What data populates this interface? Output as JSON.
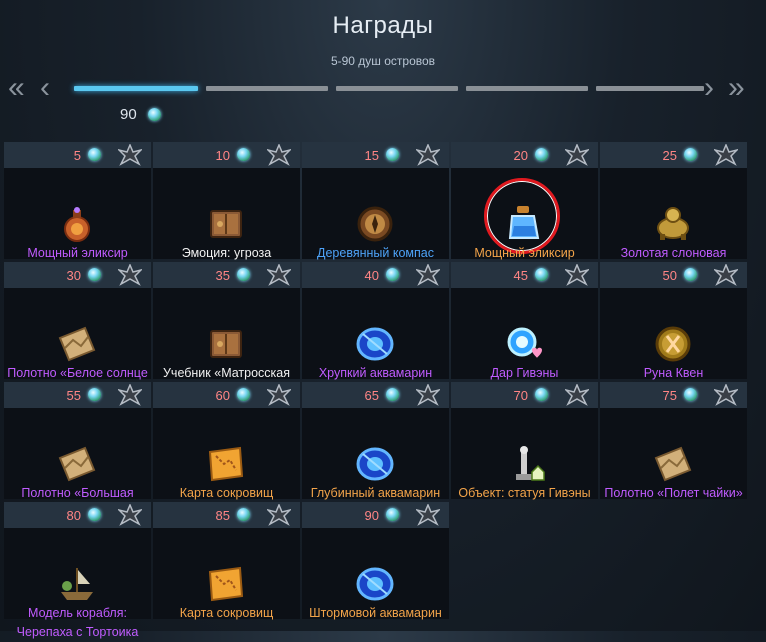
{
  "header": {
    "title": "Награды",
    "subtitle": "5-90 душ островов",
    "progress_value": "90"
  },
  "nav": {
    "first": "«",
    "prev": "‹",
    "next": "›",
    "last": "»"
  },
  "rewards": [
    {
      "souls": "5",
      "name": "Мощный эликсир «Благословени…",
      "color": "#c05cff",
      "icon": "elixir-icon"
    },
    {
      "souls": "10",
      "name": "Эмоция: угроза",
      "color": "#f1f1f1",
      "icon": "book-icon"
    },
    {
      "souls": "15",
      "name": "Деревянный компас",
      "color": "#4ea3f8",
      "icon": "compass-icon"
    },
    {
      "souls": "20",
      "name": "Мощный эликсир умений",
      "color": "#f3a44a",
      "icon": "potion-icon"
    },
    {
      "souls": "25",
      "name": "Золотая слоновая черепаха",
      "color": "#c05cff",
      "icon": "turtle-icon"
    },
    {
      "souls": "30",
      "name": "Полотно «Белое солнце Гуджира»",
      "color": "#c05cff",
      "icon": "canvas-icon"
    },
    {
      "souls": "35",
      "name": "Учебник «Матросская пляска»",
      "color": "#f1f1f1",
      "icon": "book-icon"
    },
    {
      "souls": "40",
      "name": "Хрупкий аквамарин",
      "color": "#c05cff",
      "icon": "aquamarine-icon"
    },
    {
      "souls": "45",
      "name": "Дар Гивэны",
      "color": "#c05cff",
      "icon": "gift-orb-icon"
    },
    {
      "souls": "50",
      "name": "Руна Квен",
      "color": "#c05cff",
      "icon": "rune-icon"
    },
    {
      "souls": "55",
      "name": "Полотно «Большая волна в Лазурно…",
      "color": "#c05cff",
      "icon": "canvas-icon"
    },
    {
      "souls": "60",
      "name": "Карта сокровищ",
      "color": "#f3a44a",
      "icon": "treasure-map-icon"
    },
    {
      "souls": "65",
      "name": "Глубинный аквамарин",
      "color": "#f3a44a",
      "icon": "aquamarine-icon"
    },
    {
      "souls": "70",
      "name": "Объект: статуя Гивэны",
      "color": "#f3a44a",
      "icon": "statue-icon"
    },
    {
      "souls": "75",
      "name": "Полотно «Полет чайки»",
      "color": "#c05cff",
      "icon": "canvas-icon"
    },
    {
      "souls": "80",
      "name": "Модель корабля: Черепаха с Тортоика",
      "color": "#c05cff",
      "icon": "ship-model-icon"
    },
    {
      "souls": "85",
      "name": "Карта сокровищ",
      "color": "#f3a44a",
      "icon": "treasure-map-icon"
    },
    {
      "souls": "90",
      "name": "Штормовой аквамарин",
      "color": "#f3a44a",
      "icon": "aquamarine-icon"
    }
  ]
}
